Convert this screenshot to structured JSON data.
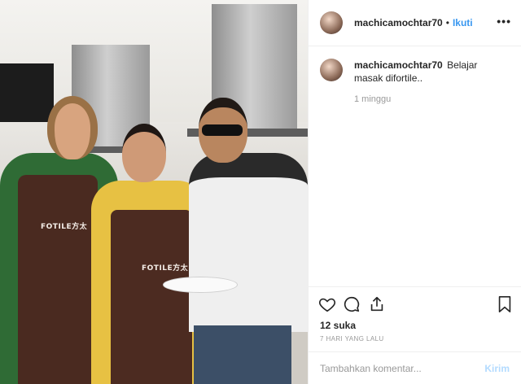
{
  "photo": {
    "brand_text_1": "FOTILE方太",
    "brand_text_2": "FOTILE方太"
  },
  "header": {
    "username": "machicamochtar70",
    "separator": "•",
    "follow_label": "Ikuti",
    "more_label": "•••"
  },
  "caption": {
    "username": "machicamochtar70",
    "text": "Belajar masak difortile..",
    "time": "1 minggu"
  },
  "actions": {
    "icons": [
      "heart-icon",
      "comment-icon",
      "share-icon",
      "bookmark-icon"
    ],
    "likes": "12 suka",
    "date": "7 HARI YANG LALU"
  },
  "comment_box": {
    "placeholder": "Tambahkan komentar...",
    "post_label": "Kirim"
  },
  "colors": {
    "link": "#3897f0",
    "muted": "#999999",
    "text": "#262626",
    "disabled_post": "#b3dbff"
  }
}
